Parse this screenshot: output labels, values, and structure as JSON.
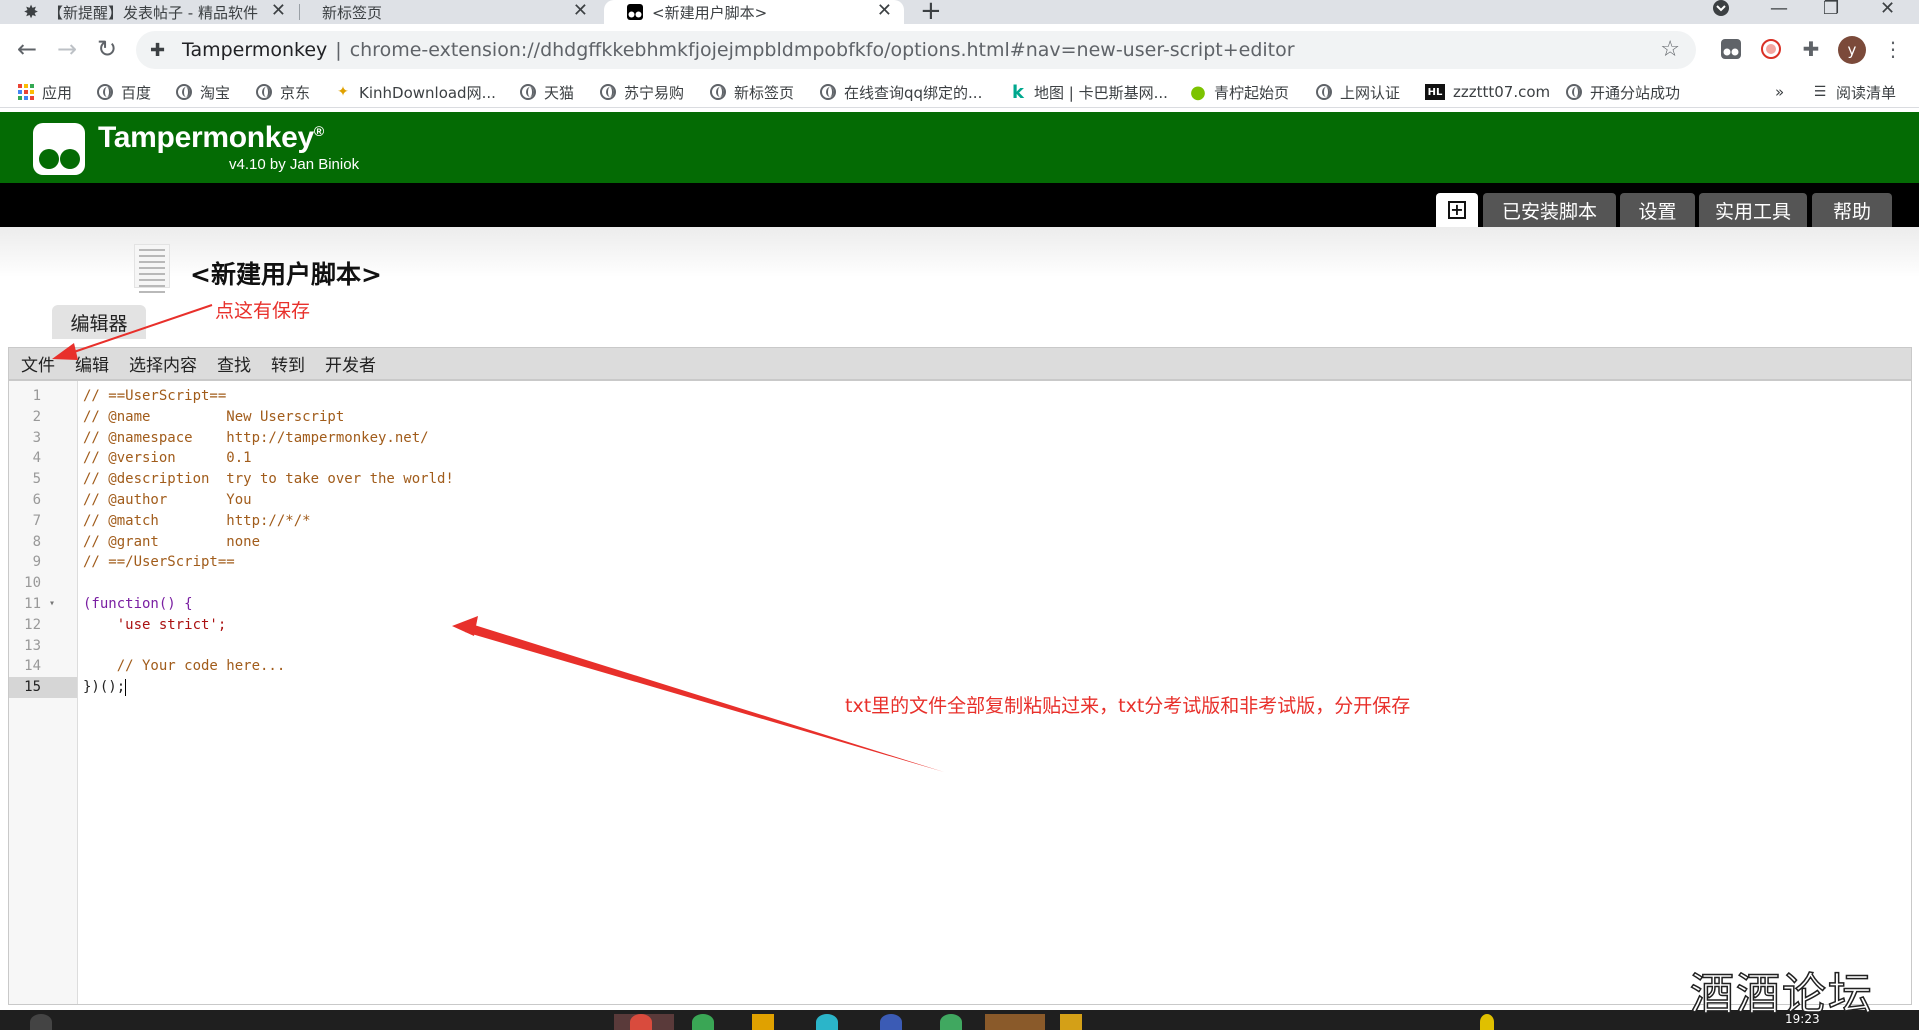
{
  "browser": {
    "tabs": [
      {
        "title": "【新提醒】发表帖子 - 精品软件",
        "close": "✕"
      },
      {
        "title": "新标签页",
        "close": "✕"
      },
      {
        "title": "<新建用户脚本>",
        "close": "✕"
      }
    ],
    "new_tab_symbol": "+",
    "window_controls": {
      "minimize": "—",
      "restore": "❐",
      "close": "✕"
    },
    "address": {
      "site": "Tampermonkey",
      "divider": "|",
      "url": "chrome-extension://dhdgffkkebhmkfjojejmpbldmpobfkfo/options.html#nav=new-user-script+editor"
    },
    "profile_initial": "y",
    "bookmarks": [
      {
        "label": "应用",
        "icon": "apps-grid-icon"
      },
      {
        "label": "百度",
        "icon": "globe-icon"
      },
      {
        "label": "淘宝",
        "icon": "globe-icon"
      },
      {
        "label": "京东",
        "icon": "globe-icon"
      },
      {
        "label": "KinhDownload网...",
        "icon": "kinh-icon"
      },
      {
        "label": "天猫",
        "icon": "globe-icon"
      },
      {
        "label": "苏宁易购",
        "icon": "globe-icon"
      },
      {
        "label": "新标签页",
        "icon": "globe-icon"
      },
      {
        "label": "在线查询qq绑定的...",
        "icon": "globe-icon"
      },
      {
        "label": "地图 | 卡巴斯基网...",
        "icon": "k-icon"
      },
      {
        "label": "青柠起始页",
        "icon": "lime-icon"
      },
      {
        "label": "上网认证",
        "icon": "globe-icon"
      },
      {
        "label": "zzzttt07.com",
        "icon": "hl-icon"
      },
      {
        "label": "开通分站成功",
        "icon": "globe-icon"
      }
    ],
    "bookmarks_overflow": "»",
    "reading_list": "阅读清单"
  },
  "tampermonkey": {
    "title": "Tampermonkey",
    "trademark": "®",
    "version": "v4.10 by Jan Biniok",
    "nav": {
      "new_script": "+",
      "installed": "已安装脚本",
      "settings": "设置",
      "utilities": "实用工具",
      "help": "帮助"
    },
    "page_title": "<新建用户脚本>",
    "editor_tab": "编辑器",
    "menu": [
      "文件",
      "编辑",
      "选择内容",
      "查找",
      "转到",
      "开发者"
    ]
  },
  "editor": {
    "line_numbers": [
      "1",
      "2",
      "3",
      "4",
      "5",
      "6",
      "7",
      "8",
      "9",
      "10",
      "11",
      "12",
      "13",
      "14",
      "15"
    ],
    "active_line": "15",
    "lines": [
      "// ==UserScript==",
      "// @name         New Userscript",
      "// @namespace    http://tampermonkey.net/",
      "// @version      0.1",
      "// @description  try to take over the world!",
      "// @author       You",
      "// @match        http://*/*",
      "// @grant        none",
      "// ==/UserScript==",
      "",
      "(function() {",
      "    'use strict';",
      "",
      "    // Your code here...",
      "})();"
    ]
  },
  "annotations": {
    "save_hint": "点这有保存",
    "paste_hint": "txt里的文件全部复制粘贴过来，txt分考试版和非考试版，分开保存",
    "color": "#e8302b"
  },
  "taskbar": {
    "clock": "19:23"
  },
  "watermark": "酒酒论坛"
}
